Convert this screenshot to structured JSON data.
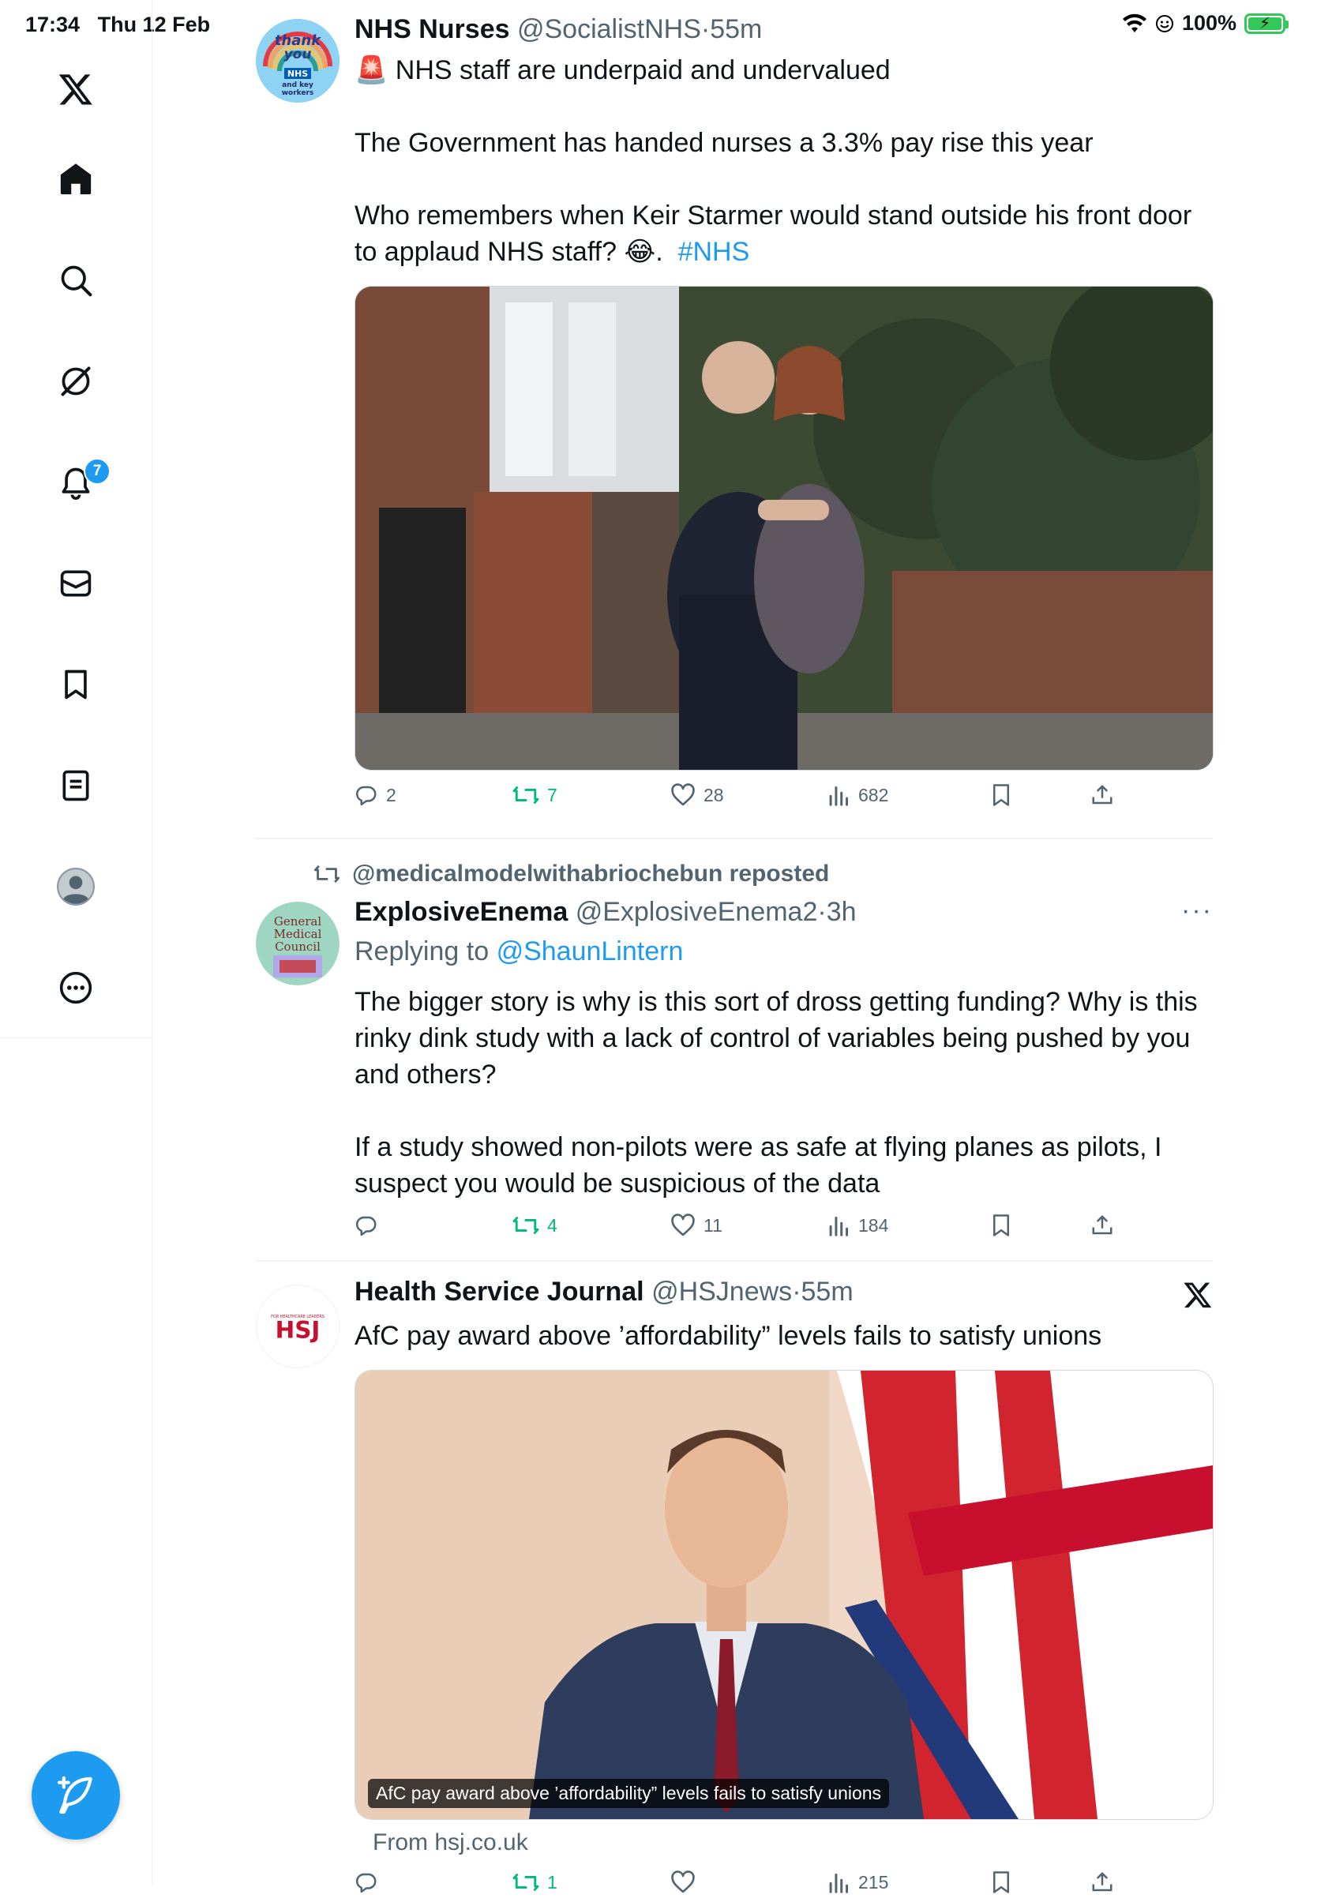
{
  "status_bar": {
    "time": "17:34",
    "date": "Thu 12 Feb",
    "battery": "100%"
  },
  "sidebar": {
    "items": [
      {
        "name": "x-logo-icon"
      },
      {
        "name": "home-icon"
      },
      {
        "name": "search-icon"
      },
      {
        "name": "grok-icon"
      },
      {
        "name": "notifications-icon",
        "badge": "7"
      },
      {
        "name": "messages-icon"
      },
      {
        "name": "bookmarks-icon"
      },
      {
        "name": "lists-icon"
      },
      {
        "name": "profile-icon"
      },
      {
        "name": "more-icon"
      }
    ],
    "compose_icon": "compose-feather-icon"
  },
  "tweets": [
    {
      "avatar_text": [
        "thank",
        "you",
        "NHS",
        "and key",
        "workers"
      ],
      "name": "NHS Nurses",
      "handle": "@SocialistNHS",
      "time": "55m",
      "lines": [
        "🚨 NHS staff are underpaid and undervalued",
        "The Government has handed nurses a 3.3% pay rise this year",
        "Who remembers when Keir Starmer would stand outside his front door to applaud NHS staff? 😂.",
        "#NHS"
      ],
      "stats": {
        "replies": "2",
        "reposts": "7",
        "likes": "28",
        "views": "682"
      }
    },
    {
      "reposted_by": "@medicalmodelwithabriochebun reposted",
      "avatar_text": [
        "General",
        "Medical",
        "Council"
      ],
      "name": "ExplosiveEnema",
      "handle": "@ExplosiveEnema2",
      "time": "3h",
      "more": "···",
      "replying_prefix": "Replying to",
      "replying_to": "@ShaunLintern",
      "lines": [
        "The bigger story is why is this sort of dross getting funding? Why is this rinky dink study with  a lack of control of variables being pushed by you and others?",
        "If a study showed non-pilots were as safe at flying planes as pilots, I suspect you would be suspicious of the data"
      ],
      "stats": {
        "replies": "",
        "reposts": "4",
        "likes": "11",
        "views": "184"
      }
    },
    {
      "avatar_text": [
        "FOR HEALTHCARE LEADERS",
        "HSJ"
      ],
      "name": "Health Service Journal",
      "handle": "@HSJnews",
      "time": "55m",
      "lines": [
        "AfC pay award above ’affordability” levels fails to satisfy unions"
      ],
      "card_caption": "AfC pay award above ’affordability” levels fails to satisfy unions",
      "card_source": "From hsj.co.uk",
      "stats": {
        "replies": "",
        "reposts": "1",
        "likes": "",
        "views": "215"
      }
    }
  ],
  "separator_dot": "·"
}
